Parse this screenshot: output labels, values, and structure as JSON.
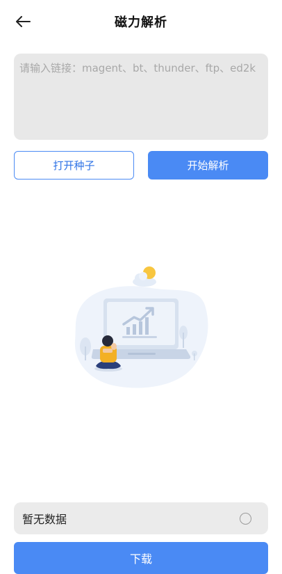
{
  "header": {
    "title": "磁力解析",
    "back_icon": "arrow-left-icon"
  },
  "link_input": {
    "placeholder": "请输入链接：magent、bt、thunder、ftp、ed2k",
    "value": ""
  },
  "actions": {
    "open_seed_label": "打开种子",
    "start_parse_label": "开始解析"
  },
  "empty_illustration": {
    "icon": "laptop-chart-person-illustration"
  },
  "status": {
    "text": "暂无数据",
    "checked": false
  },
  "footer": {
    "download_label": "下载"
  },
  "colors": {
    "accent": "#4a8af4",
    "input_bg": "#e8e8e8",
    "status_bg": "#ebebeb"
  }
}
